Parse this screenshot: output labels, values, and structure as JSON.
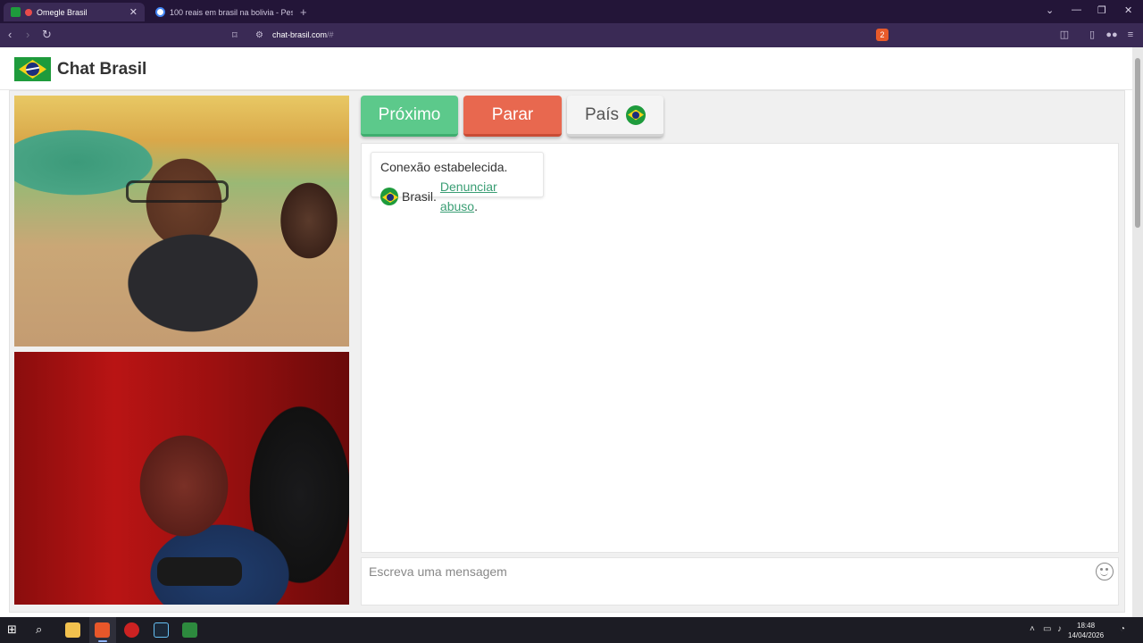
{
  "browser": {
    "tabs": [
      {
        "title": "Omegle Brasil",
        "active": true
      },
      {
        "title": "100 reais em brasil na bolivia - Pesqu",
        "active": false
      }
    ],
    "new_tab": "+",
    "url_host": "chat-brasil.com",
    "url_path": "/#",
    "brave_badge": "2"
  },
  "site": {
    "title": "Chat Brasil"
  },
  "controls": {
    "next_label": "Próximo",
    "stop_label": "Parar",
    "country_label": "País"
  },
  "chat": {
    "status": "Conexão estabelecida.",
    "country": "Brasil.",
    "report_link": "Denunciar abuso",
    "report_suffix": "."
  },
  "compose": {
    "placeholder": "Escreva uma mensagem"
  },
  "taskbar": {
    "time": "18:48",
    "date": "14/04/2026"
  },
  "colors": {
    "next": "#5cc98b",
    "stop": "#e8684f",
    "link": "#3a9e74",
    "browser_chrome": "#3a2a55"
  }
}
